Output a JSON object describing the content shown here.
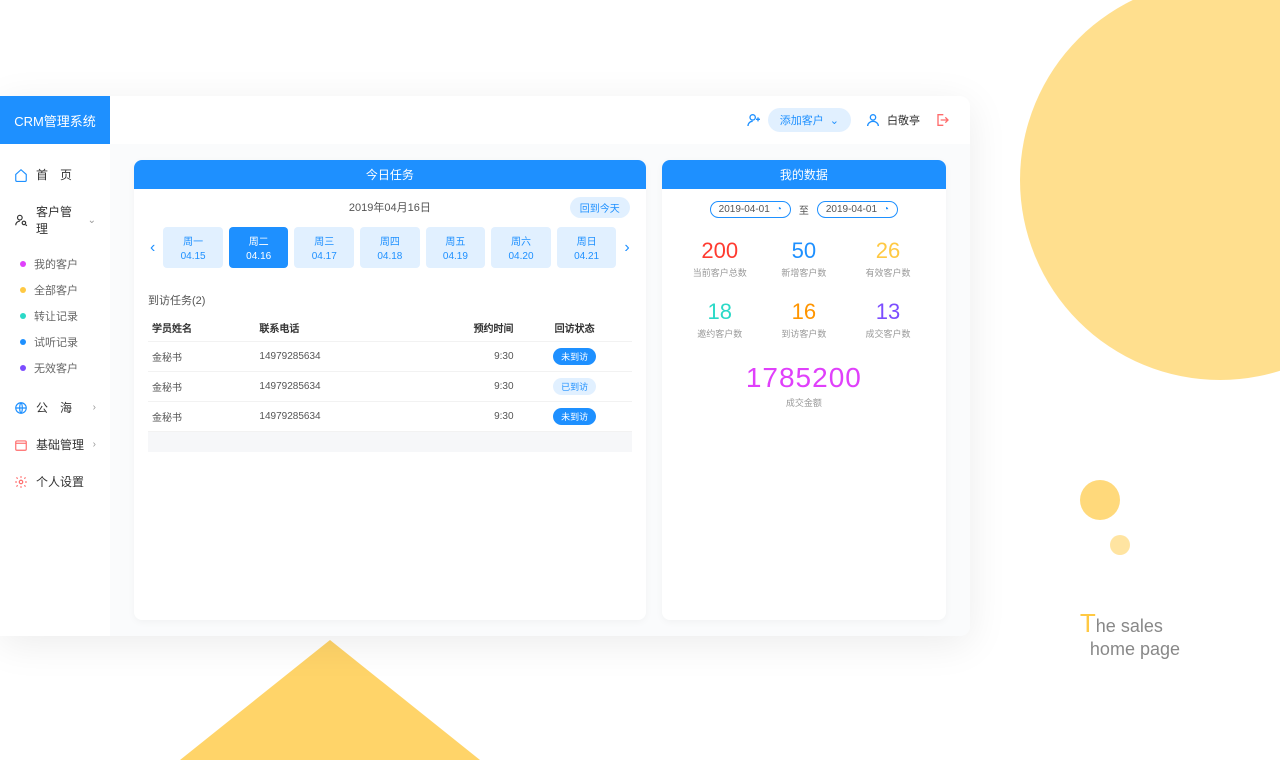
{
  "app_title": "CRM管理系统",
  "header": {
    "add_label": "添加客户",
    "username": "白敬亭"
  },
  "sidebar": {
    "home": "首　页",
    "customer_mgmt": "客户管理",
    "sub": [
      {
        "label": "我的客户",
        "color": "#E040FB"
      },
      {
        "label": "全部客户",
        "color": "#FFC943"
      },
      {
        "label": "转让记录",
        "color": "#2BD9C7"
      },
      {
        "label": "试听记录",
        "color": "#1E90FF"
      },
      {
        "label": "无效客户",
        "color": "#7C4DFF"
      }
    ],
    "public_sea": "公　海",
    "base_mgmt": "基础管理",
    "personal": "个人设置"
  },
  "today_task": {
    "title": "今日任务",
    "date_label": "2019年04月16日",
    "back_today": "回到今天",
    "days": [
      {
        "name": "周一",
        "date": "04.15"
      },
      {
        "name": "周二",
        "date": "04.16"
      },
      {
        "name": "周三",
        "date": "04.17"
      },
      {
        "name": "周四",
        "date": "04.18"
      },
      {
        "name": "周五",
        "date": "04.19"
      },
      {
        "name": "周六",
        "date": "04.20"
      },
      {
        "name": "周日",
        "date": "04.21"
      }
    ],
    "active_day_index": 1,
    "task_header": "到访任务(2)",
    "columns": {
      "name": "学员姓名",
      "phone": "联系电话",
      "time": "预约时间",
      "status": "回访状态"
    },
    "rows": [
      {
        "name": "金秘书",
        "phone": "14979285634",
        "time": "9:30",
        "status": "未到访",
        "done": false
      },
      {
        "name": "金秘书",
        "phone": "14979285634",
        "time": "9:30",
        "status": "已到访",
        "done": true
      },
      {
        "name": "金秘书",
        "phone": "14979285634",
        "time": "9:30",
        "status": "未到访",
        "done": false
      }
    ]
  },
  "my_data": {
    "title": "我的数据",
    "date_from": "2019-04-01",
    "date_sep": "至",
    "date_to": "2019-04-01",
    "kpis": [
      {
        "value": "200",
        "label": "当前客户总数",
        "color": "#FF3B30"
      },
      {
        "value": "50",
        "label": "新增客户数",
        "color": "#1E90FF"
      },
      {
        "value": "26",
        "label": "有效客户数",
        "color": "#FFC943"
      },
      {
        "value": "18",
        "label": "邀约客户数",
        "color": "#2BD9C7"
      },
      {
        "value": "16",
        "label": "到访客户数",
        "color": "#FF9500"
      },
      {
        "value": "13",
        "label": "成交客户数",
        "color": "#7C4DFF"
      }
    ],
    "total": {
      "value": "1785200",
      "label": "成交金额"
    }
  },
  "caption": {
    "line1": "he sales",
    "line2": "home page"
  }
}
